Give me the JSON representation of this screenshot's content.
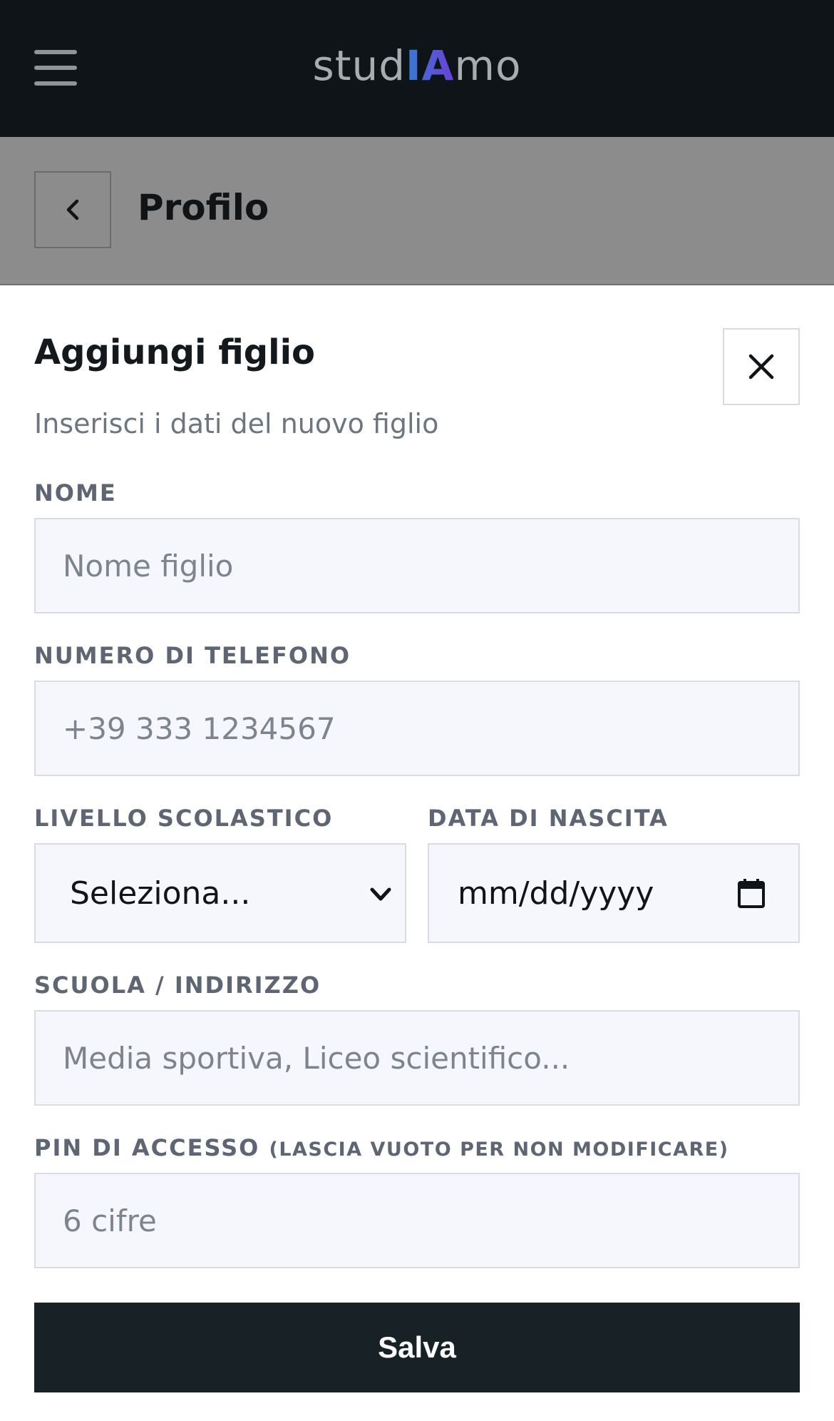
{
  "app": {
    "logo_prefix": "stud",
    "logo_highlight": "IA",
    "logo_suffix": "mo",
    "menu_icon": "hamburger-menu-icon"
  },
  "page": {
    "title": "Profilo",
    "back_icon": "chevron-left-icon"
  },
  "sheet": {
    "title": "Aggiungi figlio",
    "subtitle": "Inserisci i dati del nuovo figlio",
    "close_icon": "close-icon",
    "fields": {
      "name": {
        "label": "NOME",
        "placeholder": "Nome figlio",
        "value": ""
      },
      "phone": {
        "label": "NUMERO DI TELEFONO",
        "placeholder": "+39 333 1234567",
        "value": ""
      },
      "level": {
        "label": "LIVELLO SCOLASTICO",
        "selected": "Seleziona..."
      },
      "birthdate": {
        "label": "DATA DI NASCITA",
        "placeholder": "mm/dd/yyyy",
        "icon": "calendar-icon"
      },
      "school": {
        "label": "SCUOLA / INDIRIZZO",
        "placeholder": "Media sportiva, Liceo scientifico...",
        "value": ""
      },
      "pin": {
        "label": "PIN DI ACCESSO",
        "label_note": "(LASCIA VUOTO PER NON MODIFICARE)",
        "placeholder": "6 cifre",
        "value": ""
      }
    },
    "save_label": "Salva"
  },
  "colors": {
    "topbar": "#0f1418",
    "overlay": "#8c8c8c",
    "button": "#182126",
    "field_bg": "#f6f7fc",
    "logo_accent_start": "#3a7bd5",
    "logo_accent_end": "#6a3fd6"
  }
}
